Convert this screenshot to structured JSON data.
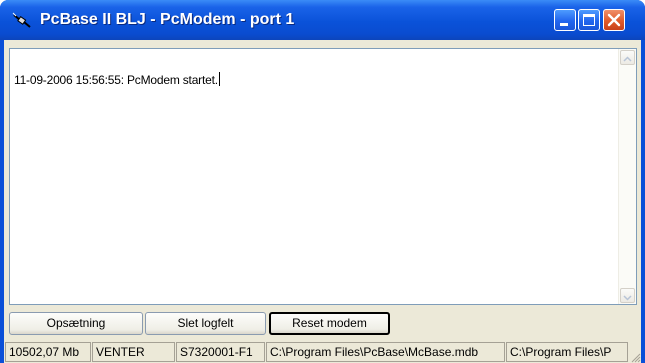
{
  "window": {
    "title": "PcBase II BLJ - PcModem - port 1",
    "icon": "plug-icon",
    "controls": [
      "minimize-icon",
      "maximize-icon",
      "close-icon"
    ]
  },
  "log": {
    "lines": [
      "11-09-2006 15:56:55: PcModem startet."
    ]
  },
  "buttons": {
    "setup": "Opsætning",
    "clear_log": "Slet logfelt",
    "reset_modem": "Reset modem"
  },
  "statusbar": {
    "panels": [
      "10502,07 Mb",
      "VENTER",
      "S7320001-F1",
      "C:\\Program Files\\PcBase\\McBase.mdb",
      "C:\\Program Files\\P"
    ]
  },
  "colors": {
    "titlebar": "#0a52d9",
    "close_button": "#e05a2a",
    "face": "#ece9d8"
  }
}
